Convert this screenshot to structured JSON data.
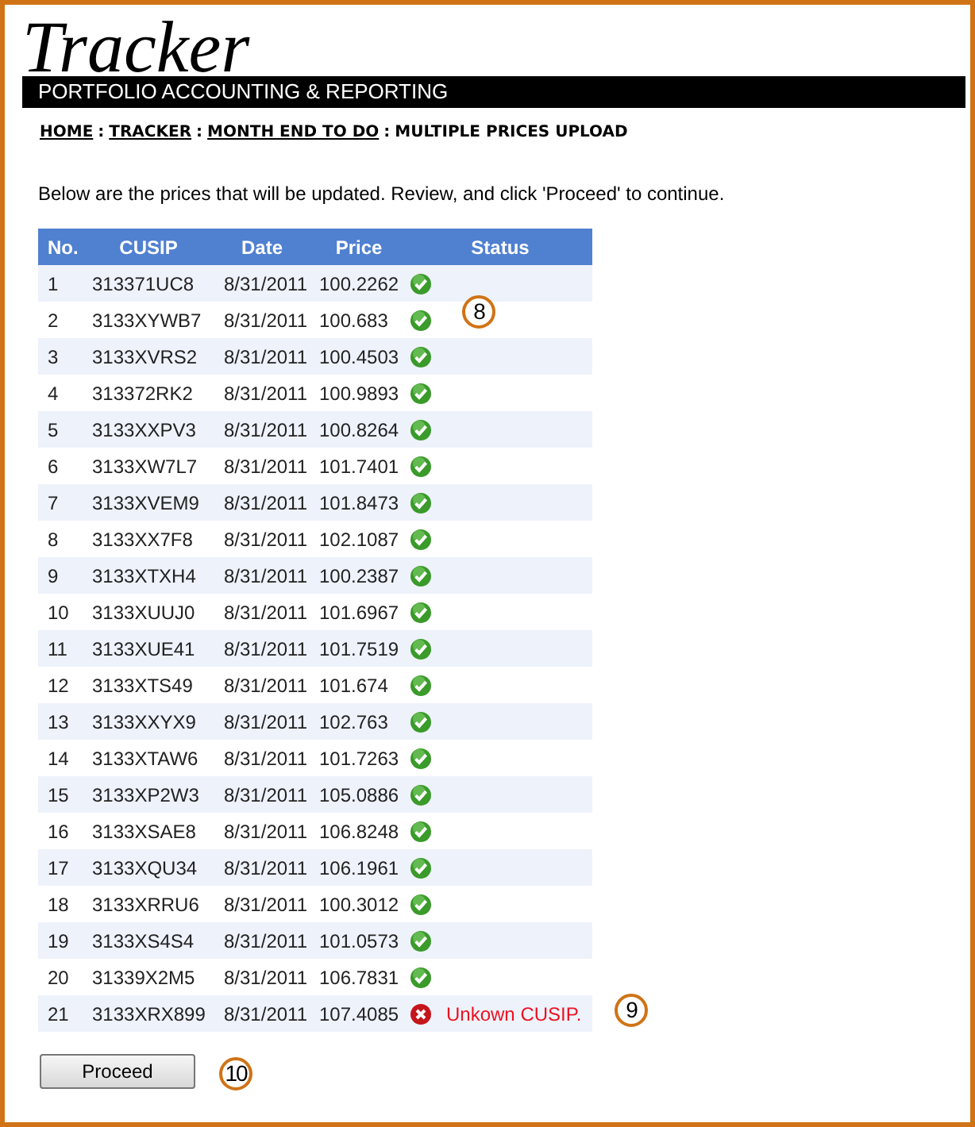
{
  "header": {
    "title": "Tracker",
    "subtitle": "PORTFOLIO ACCOUNTING & REPORTING"
  },
  "breadcrumb": {
    "links": [
      "HOME",
      "TRACKER",
      "MONTH END TO DO"
    ],
    "separator": ":",
    "current": "MULTIPLE PRICES UPLOAD"
  },
  "intro": "Below are the prices that will be updated. Review, and click 'Proceed' to continue.",
  "table": {
    "columns": [
      "No.",
      "CUSIP",
      "Date",
      "Price",
      "Status"
    ],
    "rows": [
      {
        "no": "1",
        "cusip": "313371UC8",
        "date": "8/31/2011",
        "price": "100.2262",
        "kind": "ok"
      },
      {
        "no": "2",
        "cusip": "3133XYWB7",
        "date": "8/31/2011",
        "price": "100.683",
        "kind": "ok"
      },
      {
        "no": "3",
        "cusip": "3133XVRS2",
        "date": "8/31/2011",
        "price": "100.4503",
        "kind": "ok"
      },
      {
        "no": "4",
        "cusip": "313372RK2",
        "date": "8/31/2011",
        "price": "100.9893",
        "kind": "ok"
      },
      {
        "no": "5",
        "cusip": "3133XXPV3",
        "date": "8/31/2011",
        "price": "100.8264",
        "kind": "ok"
      },
      {
        "no": "6",
        "cusip": "3133XW7L7",
        "date": "8/31/2011",
        "price": "101.7401",
        "kind": "ok"
      },
      {
        "no": "7",
        "cusip": "3133XVEM9",
        "date": "8/31/2011",
        "price": "101.8473",
        "kind": "ok"
      },
      {
        "no": "8",
        "cusip": "3133XX7F8",
        "date": "8/31/2011",
        "price": "102.1087",
        "kind": "ok"
      },
      {
        "no": "9",
        "cusip": "3133XTXH4",
        "date": "8/31/2011",
        "price": "100.2387",
        "kind": "ok"
      },
      {
        "no": "10",
        "cusip": "3133XUUJ0",
        "date": "8/31/2011",
        "price": "101.6967",
        "kind": "ok"
      },
      {
        "no": "11",
        "cusip": "3133XUE41",
        "date": "8/31/2011",
        "price": "101.7519",
        "kind": "ok"
      },
      {
        "no": "12",
        "cusip": "3133XTS49",
        "date": "8/31/2011",
        "price": "101.674",
        "kind": "ok"
      },
      {
        "no": "13",
        "cusip": "3133XXYX9",
        "date": "8/31/2011",
        "price": "102.763",
        "kind": "ok"
      },
      {
        "no": "14",
        "cusip": "3133XTAW6",
        "date": "8/31/2011",
        "price": "101.7263",
        "kind": "ok"
      },
      {
        "no": "15",
        "cusip": "3133XP2W3",
        "date": "8/31/2011",
        "price": "105.0886",
        "kind": "ok"
      },
      {
        "no": "16",
        "cusip": "3133XSAE8",
        "date": "8/31/2011",
        "price": "106.8248",
        "kind": "ok"
      },
      {
        "no": "17",
        "cusip": "3133XQU34",
        "date": "8/31/2011",
        "price": "106.1961",
        "kind": "ok"
      },
      {
        "no": "18",
        "cusip": "3133XRRU6",
        "date": "8/31/2011",
        "price": "100.3012",
        "kind": "ok"
      },
      {
        "no": "19",
        "cusip": "3133XS4S4",
        "date": "8/31/2011",
        "price": "101.0573",
        "kind": "ok"
      },
      {
        "no": "20",
        "cusip": "31339X2M5",
        "date": "8/31/2011",
        "price": "106.7831",
        "kind": "ok"
      },
      {
        "no": "21",
        "cusip": "3133XRX899",
        "date": "8/31/2011",
        "price": "107.4085",
        "kind": "error",
        "message": "Unkown CUSIP."
      }
    ]
  },
  "button": "Proceed",
  "callouts": [
    "8",
    "9",
    "10"
  ]
}
